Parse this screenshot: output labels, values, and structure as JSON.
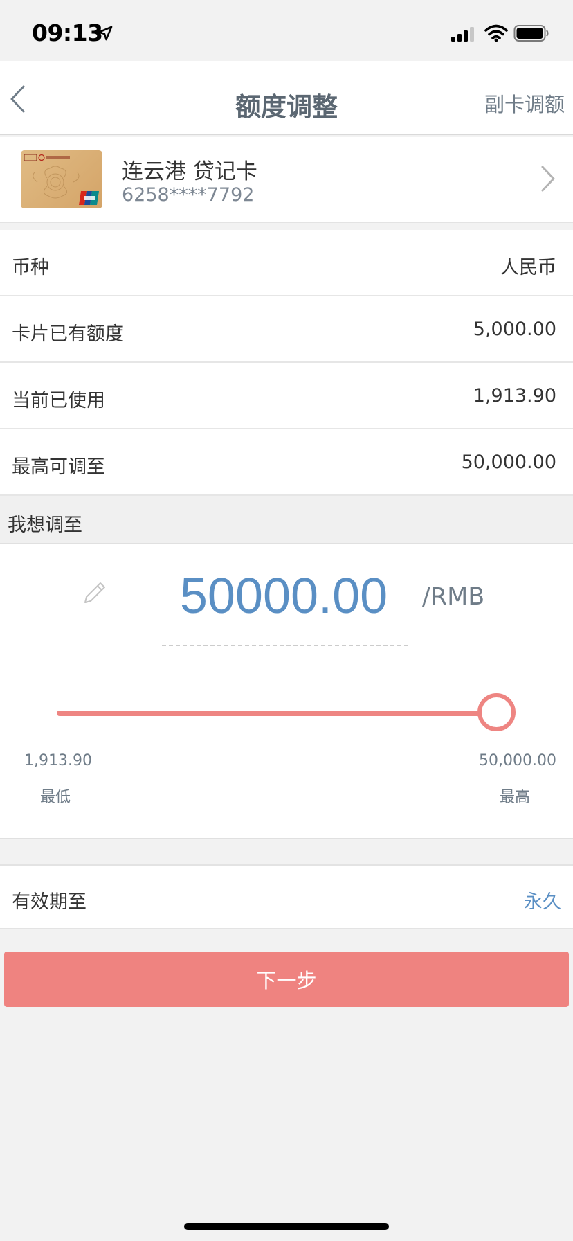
{
  "status_bar": {
    "time": "09:13",
    "icons": [
      "location-arrow-icon",
      "cellular-signal-icon",
      "wifi-icon",
      "battery-icon"
    ]
  },
  "nav": {
    "title": "额度调整",
    "right_action": "副卡调额",
    "back_icon": "chevron-left-icon"
  },
  "card": {
    "name": "连云港 贷记卡",
    "number": "6258****7792",
    "image_logo_text": "ICBC 中国工商银行",
    "image_badge": "UnionPay 银联"
  },
  "info_rows": [
    {
      "label": "币种",
      "value": "人民币"
    },
    {
      "label": "卡片已有额度",
      "value": "5,000.00"
    },
    {
      "label": "当前已使用",
      "value": "1,913.90"
    },
    {
      "label": "最高可调至",
      "value": "50,000.00"
    }
  ],
  "adjust": {
    "section_title": "我想调至",
    "amount": "50000.00",
    "unit": "/RMB",
    "slider": {
      "min_value": "1,913.90",
      "min_label": "最低",
      "max_value": "50,000.00",
      "max_label": "最高",
      "current_fraction": 1.0
    }
  },
  "validity": {
    "label": "有效期至",
    "value": "永久"
  },
  "next_button": "下一步",
  "colors": {
    "accent_red": "#ef8380",
    "accent_blue": "#5a8fc4",
    "title_gray": "#5b6772",
    "background": "#f2f2f2"
  }
}
